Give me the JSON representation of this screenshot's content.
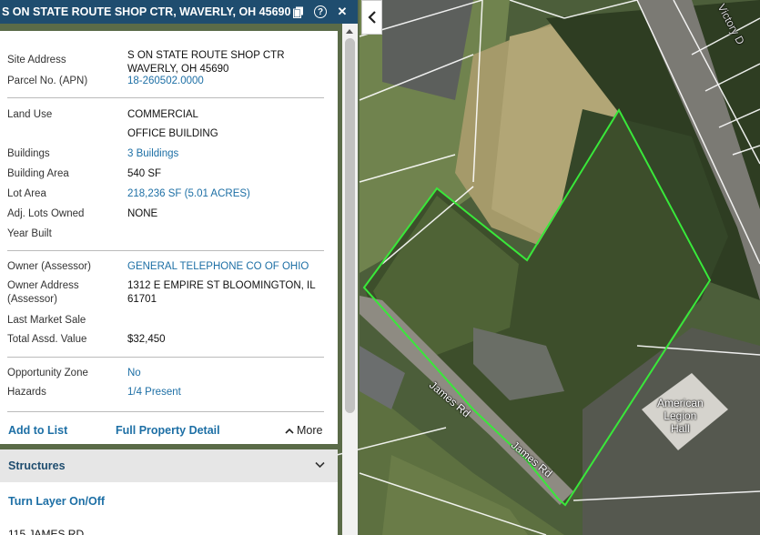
{
  "header": {
    "title": "S ON STATE ROUTE SHOP CTR, WAVERLY, OH 45690",
    "copy_icon": "copy-icon",
    "help_icon": "help-icon",
    "help_glyph": "?",
    "close_glyph": "✕"
  },
  "property": {
    "site_address_label": "Site Address",
    "site_address_line1": "S ON STATE ROUTE SHOP CTR",
    "site_address_line2": "WAVERLY, OH 45690",
    "parcel_label": "Parcel No. (APN)",
    "parcel_value": "18-260502.0000",
    "land_use_label": "Land Use",
    "land_use_value1": "COMMERCIAL",
    "land_use_value2": "OFFICE BUILDING",
    "buildings_label": "Buildings",
    "buildings_value": "3 Buildings",
    "building_area_label": "Building Area",
    "building_area_value": "540 SF",
    "lot_area_label": "Lot Area",
    "lot_area_value": "218,236 SF (5.01 ACRES)",
    "adj_lots_label": "Adj. Lots Owned",
    "adj_lots_value": "NONE",
    "year_built_label": "Year Built",
    "year_built_value": "",
    "owner_label": "Owner (Assessor)",
    "owner_value": "GENERAL TELEPHONE CO OF OHIO",
    "owner_address_label_1": "Owner Address",
    "owner_address_label_2": "(Assessor)",
    "owner_address_value": "1312 E EMPIRE ST BLOOMINGTON, IL 61701",
    "last_sale_label": "Last Market Sale",
    "last_sale_value": "",
    "assd_value_label": "Total Assd. Value",
    "assd_value_value": "$32,450",
    "opportunity_label": "Opportunity Zone",
    "opportunity_value": "No",
    "hazards_label": "Hazards",
    "hazards_value": "1/4 Present"
  },
  "actions": {
    "add_to_list": "Add to List",
    "full_detail": "Full Property Detail",
    "more": "More"
  },
  "structures": {
    "title": "Structures",
    "turn_layer": "Turn Layer On/Off",
    "first_item": "115 JAMES RD"
  },
  "map": {
    "road_label": "James Rd",
    "legion_line1": "American",
    "legion_line2": "Legion",
    "legion_line3": "Hall",
    "victory_label": "Victory D",
    "parcel_outline_color": "#39e83a"
  }
}
